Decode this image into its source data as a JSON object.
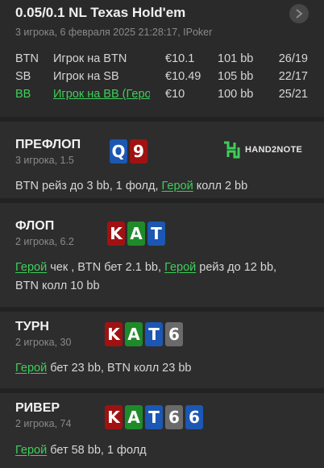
{
  "header": {
    "title": "0.05/0.1 NL Texas Hold'em",
    "subtitle": "3 игрока, 6 февраля 2025 21:28:17, IPoker",
    "next_icon": "chevron-right-icon"
  },
  "players": [
    {
      "pos": "BTN",
      "name": "Игрок на BTN",
      "stack": "€10.1",
      "bb": "101 bb",
      "dot": "·",
      "record": "26/19",
      "hero": false
    },
    {
      "pos": "SB",
      "name": "Игрок на SB",
      "stack": "€10.49",
      "bb": "105 bb",
      "dot": "·",
      "record": "22/17",
      "hero": false
    },
    {
      "pos": "BB",
      "name": "Игрок на BB (Герой)",
      "stack": "€10",
      "bb": "100 bb",
      "dot": "·",
      "record": "25/21",
      "hero": true
    }
  ],
  "colors": {
    "hero_green": "#3ecf5a",
    "card_red": "#a01212",
    "card_green": "#1f8a2a",
    "card_blue": "#1c57b3",
    "card_gray": "#6a6a6a"
  },
  "logo": {
    "text": "HAND2NOTE"
  },
  "streets": [
    {
      "name": "ПРЕФЛОП",
      "sub": "3 игрока, 1.5",
      "cards": [
        {
          "rank": "Q",
          "suit": "blue"
        },
        {
          "rank": "9",
          "suit": "red"
        }
      ],
      "action_lines": [
        [
          {
            "t": "BTN ",
            "hero": false
          },
          {
            "t": "рейз до 3 bb",
            "hero": false
          },
          {
            "t": ", 1 фолд, ",
            "hero": false
          },
          {
            "t": "Герой",
            "hero": true
          },
          {
            "t": " колл 2 bb",
            "hero": false
          }
        ]
      ]
    },
    {
      "name": "ФЛОП",
      "sub": "2 игрока, 6.2",
      "cards": [
        {
          "rank": "K",
          "suit": "red"
        },
        {
          "rank": "A",
          "suit": "green"
        },
        {
          "rank": "T",
          "suit": "blue"
        }
      ],
      "action_lines": [
        [
          {
            "t": "Герой",
            "hero": true
          },
          {
            "t": " чек , BTN бет 2.1 bb, ",
            "hero": false
          },
          {
            "t": "Герой",
            "hero": true
          },
          {
            "t": " рейз до 12 bb,",
            "hero": false
          }
        ],
        [
          {
            "t": "BTN колл 10 bb",
            "hero": false
          }
        ]
      ]
    },
    {
      "name": "ТУРН",
      "sub": "2 игрока, 30",
      "cards": [
        {
          "rank": "K",
          "suit": "red"
        },
        {
          "rank": "A",
          "suit": "green"
        },
        {
          "rank": "T",
          "suit": "blue"
        },
        {
          "rank": "6",
          "suit": "gray"
        }
      ],
      "action_lines": [
        [
          {
            "t": "Герой",
            "hero": true
          },
          {
            "t": " бет 23 bb, BTN колл 23 bb",
            "hero": false
          }
        ]
      ]
    },
    {
      "name": "РИВЕР",
      "sub": "2 игрока, 74",
      "cards": [
        {
          "rank": "K",
          "suit": "red"
        },
        {
          "rank": "A",
          "suit": "green"
        },
        {
          "rank": "T",
          "suit": "blue"
        },
        {
          "rank": "6",
          "suit": "gray"
        },
        {
          "rank": "6",
          "suit": "blue"
        }
      ],
      "action_lines": [
        [
          {
            "t": "Герой",
            "hero": true
          },
          {
            "t": " бет 58 bb, 1 фолд",
            "hero": false
          }
        ]
      ]
    }
  ]
}
